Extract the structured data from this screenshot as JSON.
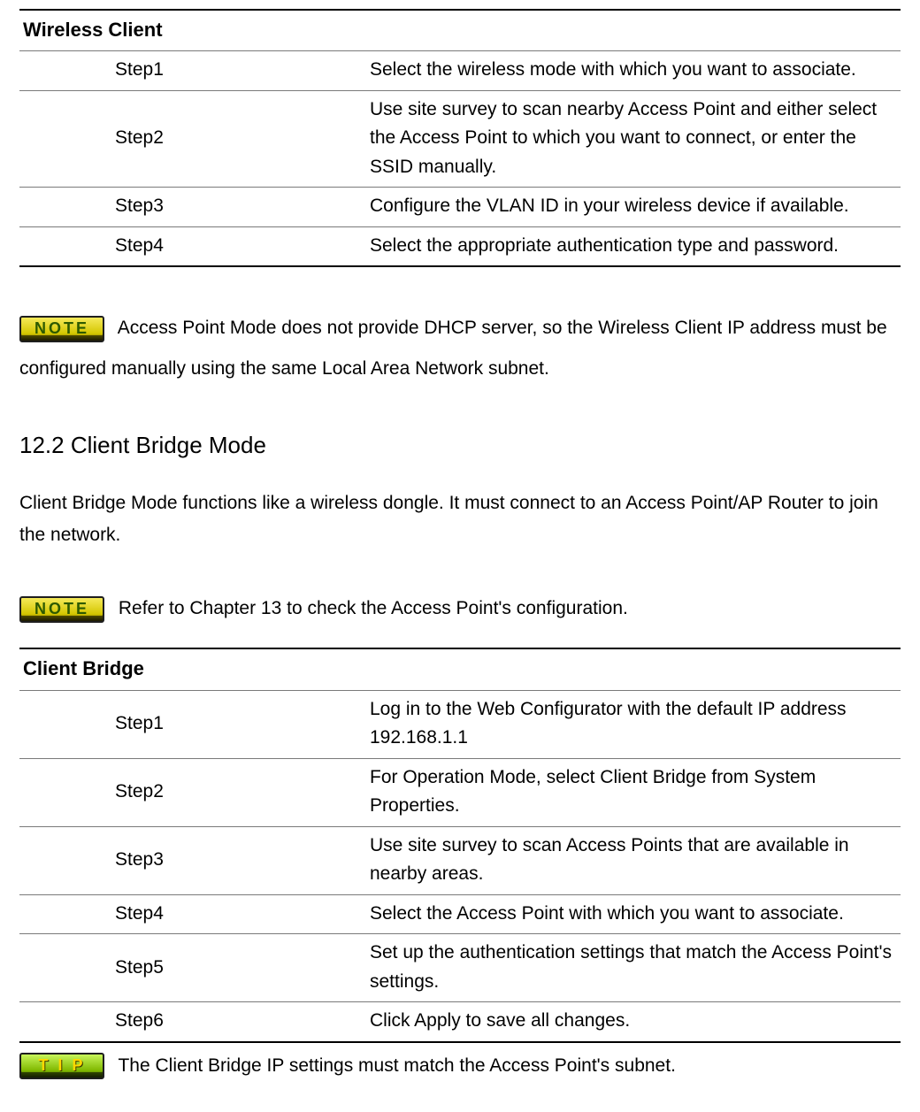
{
  "table1": {
    "header": "Wireless Client",
    "rows": [
      {
        "step": "Step1",
        "desc": "Select the wireless mode with which you want to associate."
      },
      {
        "step": "Step2",
        "desc": "Use site survey to scan nearby Access Point and either select the Access Point to which you want to connect, or enter the SSID manually."
      },
      {
        "step": "Step3",
        "desc": "Configure the VLAN ID in your wireless device if available."
      },
      {
        "step": "Step4",
        "desc": "Select the appropriate authentication type and password."
      }
    ]
  },
  "note1": {
    "badge": "NOTE",
    "text": "Access Point Mode does not provide DHCP server, so the Wireless Client IP address must be configured manually using the same Local Area Network subnet."
  },
  "section_heading": "12.2 Client Bridge Mode",
  "section_intro": "Client Bridge Mode functions like a wireless dongle. It must connect to an Access Point/AP Router to join the network.",
  "note2": {
    "badge": "NOTE",
    "text": "Refer to Chapter 13 to check the Access Point's configuration."
  },
  "table2": {
    "header": "Client Bridge",
    "rows": [
      {
        "step": "Step1",
        "desc": "Log in to the Web Configurator with the default IP address 192.168.1.1"
      },
      {
        "step": "Step2",
        "desc": "For Operation Mode, select Client Bridge from System Properties."
      },
      {
        "step": "Step3",
        "desc": "Use site survey to scan Access Points that are available in nearby areas."
      },
      {
        "step": "Step4",
        "desc": "Select the Access Point with which you want to associate."
      },
      {
        "step": "Step5",
        "desc": "Set up the authentication settings that match the Access Point's settings."
      },
      {
        "step": "Step6",
        "desc": "Click Apply to save all changes."
      }
    ]
  },
  "tip": {
    "badge": "T I P",
    "text": "The Client Bridge IP settings must match the Access Point's subnet."
  }
}
